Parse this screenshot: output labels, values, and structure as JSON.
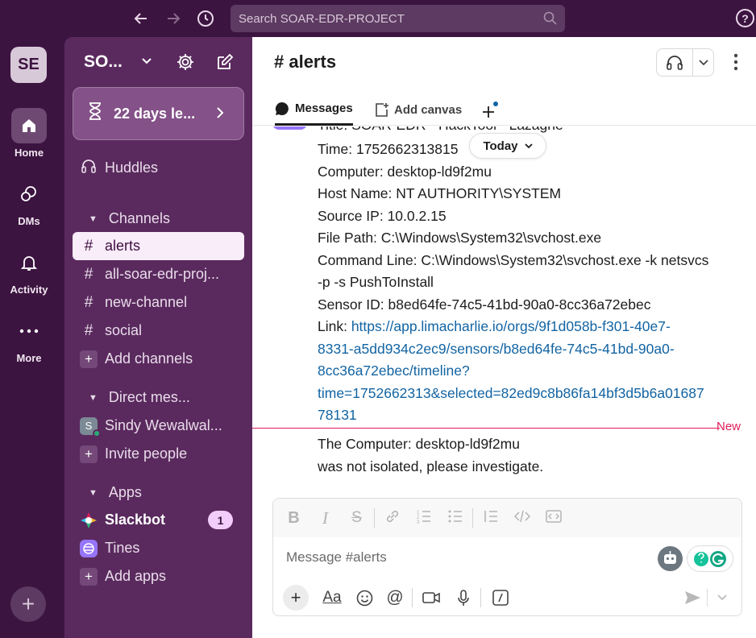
{
  "topbar": {
    "search_placeholder": "Search SOAR-EDR-PROJECT",
    "help": "?"
  },
  "rail": {
    "workspace_initials": "SE",
    "home": "Home",
    "dms": "DMs",
    "activity": "Activity",
    "more": "More"
  },
  "sidebar": {
    "workspace_name": "SO...",
    "trial_label": "22 days le...",
    "huddles": "Huddles",
    "channels_header": "Channels",
    "channels": [
      "alerts",
      "all-soar-edr-proj...",
      "new-channel",
      "social"
    ],
    "add_channels": "Add channels",
    "dm_header": "Direct mes...",
    "dm_user": "Sindy Wewalwal...",
    "invite": "Invite people",
    "apps_header": "Apps",
    "apps": [
      {
        "name": "Slackbot",
        "badge": "1"
      },
      {
        "name": "Tines"
      }
    ],
    "add_apps": "Add apps"
  },
  "channel": {
    "name": "# alerts",
    "tabs": [
      "Messages",
      "Add canvas"
    ]
  },
  "messages": {
    "today": "Today",
    "new_label": "New",
    "lines": [
      "Title: SOAR-EDR - HackTool - Lazagne",
      "Time: 1752662313815",
      "Computer: desktop-ld9f2mu",
      "Host Name: NT AUTHORITY\\SYSTEM",
      "Source IP: 10.0.2.15",
      "File Path: C:\\Windows\\System32\\svchost.exe",
      "Command Line: C:\\Windows\\System32\\svchost.exe -k netsvcs",
      "-p -s PushToInstall",
      "Sensor ID: b8ed64fe-74c5-41bd-90a0-8cc36a72ebec"
    ],
    "link_label": "Link: ",
    "link_lines": [
      "https://app.limacharlie.io/orgs/9f1d058b-f301-40e7-",
      "8331-a5dd934c2ec9/sensors/b8ed64fe-74c5-41bd-90a0-",
      "8cc36a72ebec/timeline?",
      "time=1752662313&selected=82ed9c8b86fa14bf3d5b6a01687",
      "78131"
    ],
    "after_new": [
      "The Computer: desktop-ld9f2mu",
      "was not isolated, please investigate."
    ]
  },
  "composer": {
    "placeholder": "Message #alerts",
    "text_format_label": "Aa"
  },
  "colors": {
    "aubergine": "#3c1440",
    "sidebar": "#5a2a5e",
    "link": "#1264a3",
    "new_divider": "#e01e5a"
  }
}
